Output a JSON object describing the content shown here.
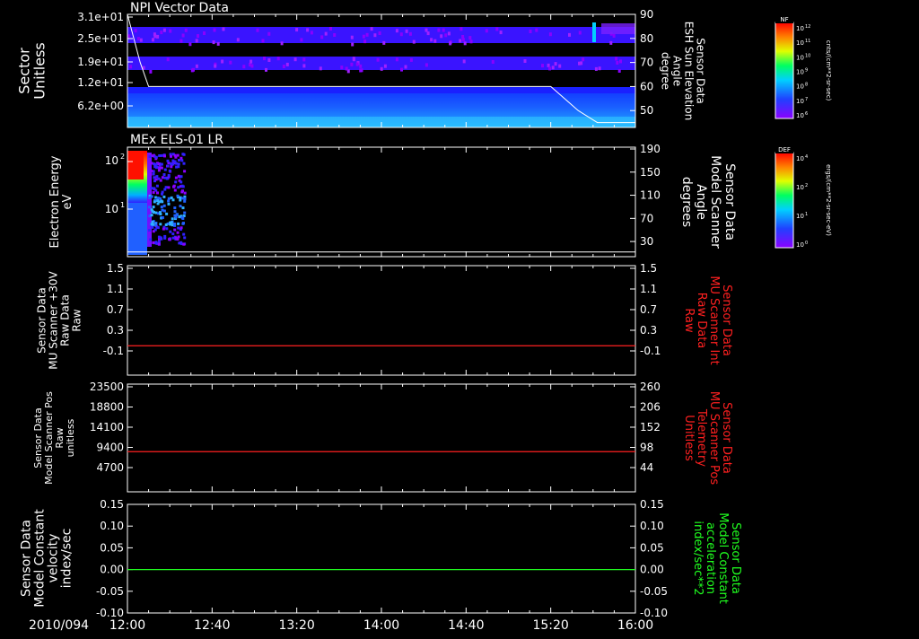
{
  "date_label": "2010/094",
  "time_ticks": [
    "12:00",
    "12:40",
    "13:20",
    "14:00",
    "14:40",
    "15:20",
    "16:00"
  ],
  "colors": {
    "frame": "#ffffff",
    "red_trace": "#ff2020",
    "green_trace": "#20ff20",
    "red_label": "#ff2020",
    "green_label": "#20ff20",
    "background": "#000000"
  },
  "chart_data": [
    {
      "type": "heatmap",
      "title": "NPI Vector Data",
      "ylabel": "Sector\nUnitless",
      "y_ticks": [
        "3.1e+01",
        "2.5e+01",
        "1.9e+01",
        "1.2e+01",
        "6.2e+00"
      ],
      "right_label": "Sensor Data\nESH Sun Elevation\nAngle\ndegree",
      "right_ticks": [
        "90",
        "80",
        "70",
        "60",
        "50"
      ],
      "right_range": [
        43,
        90
      ],
      "x_range": [
        "12:00",
        "16:00"
      ],
      "overlay_line": {
        "x": [
          "12:00",
          "12:06",
          "12:10",
          "15:20",
          "15:33",
          "15:42",
          "16:00"
        ],
        "y": [
          90,
          70,
          60,
          60,
          50,
          45,
          45
        ]
      },
      "colorbar": {
        "label": "NF",
        "units": "cnts/(cm**2-sr-sec)",
        "ticks": [
          "10^12",
          "10^11",
          "10^10",
          "10^9",
          "10^8",
          "10^7",
          "10^6"
        ]
      }
    },
    {
      "type": "heatmap",
      "title": "MEx ELS-01 LR",
      "ylabel": "Electron Energy\neV",
      "y_ticks": [
        "10^2",
        "10^1"
      ],
      "right_label": "Sensor Data\nModel Scanner\nAngle\ndegrees",
      "right_ticks": [
        "190",
        "150",
        "110",
        "70",
        "30"
      ],
      "right_range": [
        10,
        190
      ],
      "x_range": [
        "12:00",
        "16:00"
      ],
      "overlay_line": {
        "x": [
          "12:00",
          "16:00"
        ],
        "y": [
          12,
          12
        ]
      },
      "colorbar": {
        "label": "DEF",
        "units": "ergs/(cm**2-sr-sec-eV)",
        "ticks": [
          "10^4",
          "10^2",
          "10^1",
          "10^0"
        ]
      }
    },
    {
      "type": "line",
      "ylabel": "Sensor Data\nMU Scanner +30V\nRaw Data\nRaw",
      "y_ticks": [
        "1.5",
        "1.1",
        "0.7",
        "0.3",
        "-0.1"
      ],
      "ylim": [
        -0.4,
        1.5
      ],
      "right_label": "Sensor Data\nMU Scanner Int\nRaw Data\nRaw",
      "right_ticks": [
        "1.5",
        "1.1",
        "0.7",
        "0.3",
        "-0.1"
      ],
      "series": [
        {
          "values": [
            0.0,
            0.0
          ]
        }
      ],
      "x": [
        "12:00",
        "16:00"
      ],
      "color": "red"
    },
    {
      "type": "line",
      "ylabel": "Sensor Data\nModel Scanner Pos\nRaw\nunitless",
      "y_ticks": [
        "23500",
        "18800",
        "14100",
        "9400",
        "4700"
      ],
      "ylim": [
        0,
        23500
      ],
      "right_label": "Sensor Data\nMU Scanner Pos\nTelemetry\nUnitless",
      "right_ticks": [
        "260",
        "206",
        "152",
        "98",
        "44"
      ],
      "series": [
        {
          "values": [
            8400,
            8400
          ]
        }
      ],
      "x": [
        "12:00",
        "16:00"
      ],
      "color": "red"
    },
    {
      "type": "line",
      "ylabel": "Sensor Data\nModel Constant\nvelocity\nindex/sec",
      "y_ticks": [
        "0.15",
        "0.10",
        "0.05",
        "0.00",
        "-0.05",
        "-0.10"
      ],
      "ylim": [
        -0.1,
        0.15
      ],
      "right_label": "Sensor Data\nModel Constant\nacceleration\nindex/sec**2",
      "right_ticks": [
        "0.15",
        "0.10",
        "0.05",
        "0.00",
        "-0.05",
        "-0.10"
      ],
      "series": [
        {
          "values": [
            0.0,
            0.0
          ]
        }
      ],
      "x": [
        "12:00",
        "16:00"
      ],
      "color": "green"
    }
  ]
}
